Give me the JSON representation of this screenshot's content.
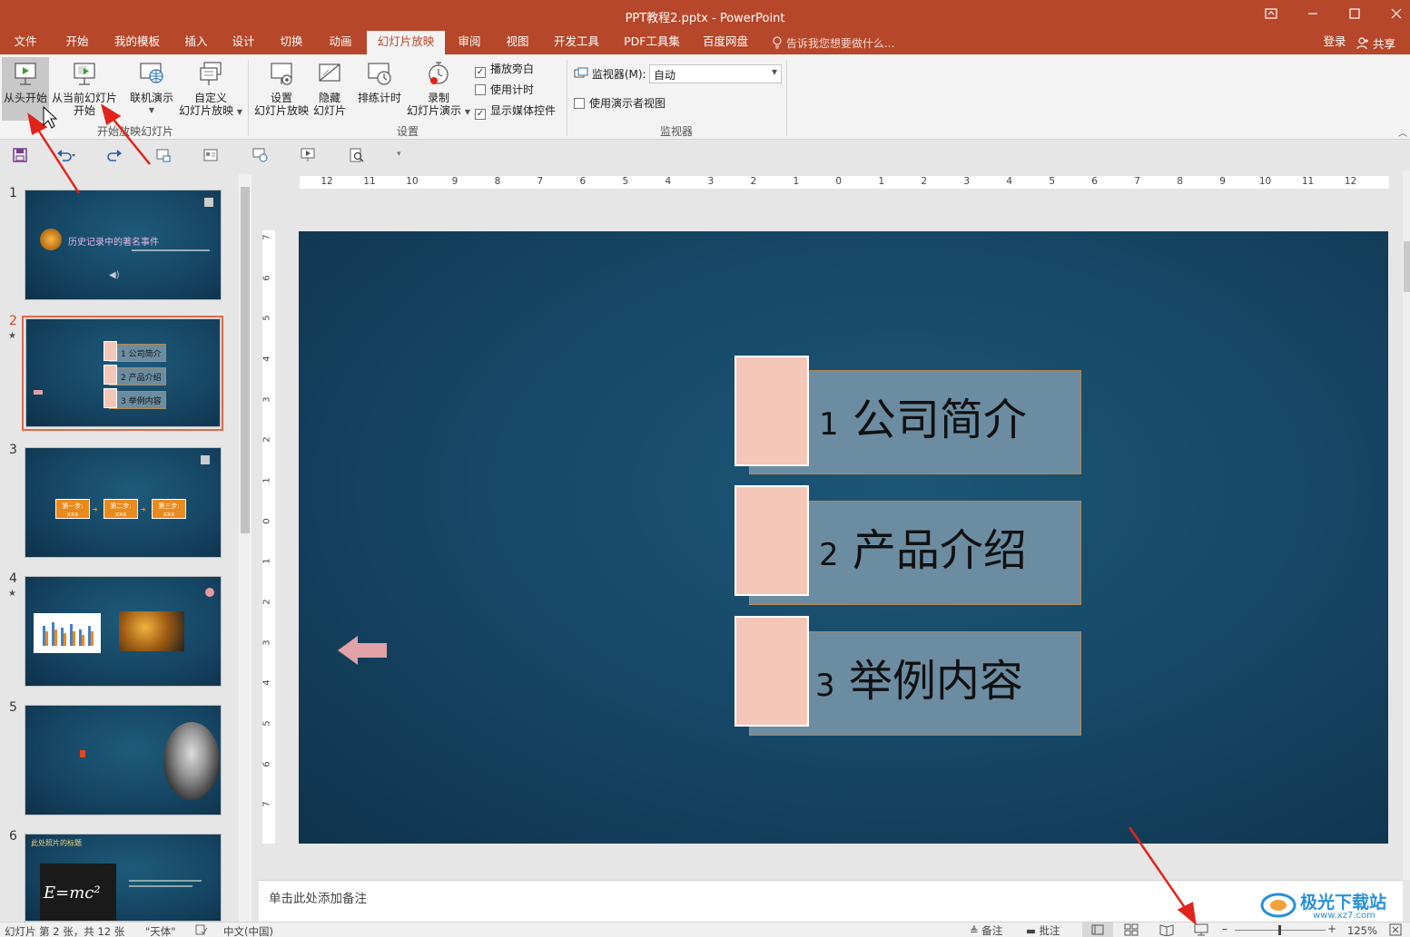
{
  "window": {
    "title": "PPT教程2.pptx - PowerPoint"
  },
  "menu": {
    "tabs": [
      "文件",
      "开始",
      "我的模板",
      "插入",
      "设计",
      "切换",
      "动画",
      "幻灯片放映",
      "审阅",
      "视图",
      "开发工具",
      "PDF工具集",
      "百度网盘"
    ],
    "active_tab": "幻灯片放映",
    "tell_me": "告诉我您想要做什么...",
    "login": "登录",
    "share": "共享"
  },
  "ribbon": {
    "start_group": {
      "from_beginning": "从头开始",
      "from_current_1": "从当前幻灯片",
      "from_current_2": "开始",
      "online_present": "联机演示",
      "custom_show_1": "自定义",
      "custom_show_2": "幻灯片放映",
      "label": "开始放映幻灯片"
    },
    "setup_group": {
      "setup_show_1": "设置",
      "setup_show_2": "幻灯片放映",
      "hide_slide_1": "隐藏",
      "hide_slide_2": "幻灯片",
      "rehearse": "排练计时",
      "record_1": "录制",
      "record_2": "幻灯片演示",
      "play_narration": "播放旁白",
      "use_timings": "使用计时",
      "show_media": "显示媒体控件",
      "label": "设置"
    },
    "monitor_group": {
      "monitor_label": "监视器(M):",
      "monitor_value": "自动",
      "presenter_view": "使用演示者视图",
      "label": "监视器"
    }
  },
  "thumbnails": [
    {
      "num": "1",
      "title": "历史记录中的著名事件"
    },
    {
      "num": "2",
      "star": "★",
      "items": [
        "1 公司简介",
        "2 产品介绍",
        "3 举例内容"
      ]
    },
    {
      "num": "3",
      "steps": [
        "第一步:",
        "第二步:",
        "第三步:"
      ],
      "sub": "xxx"
    },
    {
      "num": "4",
      "star": "★"
    },
    {
      "num": "5"
    },
    {
      "num": "6",
      "title": "此处照片的标题",
      "formula": "E=mc²"
    }
  ],
  "slide": {
    "items": [
      {
        "num": "1",
        "text": "公司简介"
      },
      {
        "num": "2",
        "text": "产品介绍"
      },
      {
        "num": "3",
        "text": "举例内容"
      }
    ]
  },
  "rulers": {
    "h_ticks": [
      "12",
      "11",
      "10",
      "9",
      "8",
      "7",
      "6",
      "5",
      "4",
      "3",
      "2",
      "1",
      "0",
      "1",
      "2",
      "3",
      "4",
      "5",
      "6",
      "7",
      "8",
      "9",
      "10",
      "11",
      "12"
    ],
    "v_ticks": [
      "7",
      "6",
      "5",
      "4",
      "3",
      "2",
      "1",
      "0",
      "1",
      "2",
      "3",
      "4",
      "5",
      "6",
      "7"
    ]
  },
  "notes": {
    "placeholder": "单击此处添加备注"
  },
  "status": {
    "slide_info": "幻灯片 第 2 张，共 12 张",
    "theme": "\"天体\"",
    "language": "中文(中国)",
    "notes_btn": "备注",
    "comments_btn": "批注",
    "zoom": "125%"
  },
  "watermark": {
    "text": "极光下载站",
    "url": "www.xz7.com"
  },
  "colors": {
    "accent": "#b7472a",
    "slide_bg": "#164766",
    "item_box": "#6c8da1",
    "item_square": "#f4c7b8",
    "arrow": "#e0241b"
  }
}
